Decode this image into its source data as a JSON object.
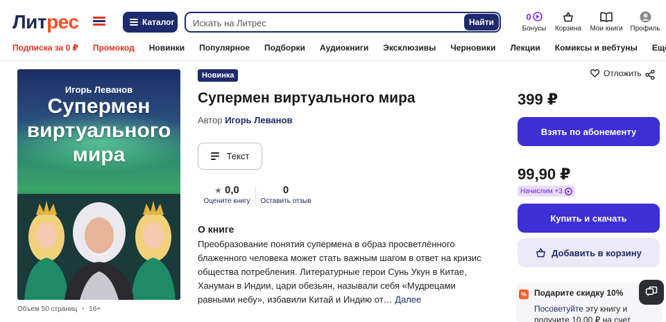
{
  "header": {
    "logo_part1": "Лит",
    "logo_part2": "рес",
    "catalog_label": "Каталог",
    "search_placeholder": "Искать на Литрес",
    "search_button": "Найти",
    "bonus_count": "0",
    "icons": {
      "bonuses": "Бонусы",
      "cart": "Корзина",
      "my_books": "Мои книги",
      "profile": "Профиль"
    }
  },
  "nav": {
    "items": [
      "Подписка за 0 ₽",
      "Промокод",
      "Новинки",
      "Популярное",
      "Подборки",
      "Аудиокниги",
      "Эксклюзивы",
      "Черновики",
      "Лекции",
      "Комиксы и вебтуны",
      "Ещё"
    ]
  },
  "cover": {
    "author": "Игорь Леванов",
    "title": "Супермен виртуального мира"
  },
  "book": {
    "badge": "Новинка",
    "title": "Супермен виртуального мира",
    "author_label": "Автор",
    "author_name": "Игорь Леванов",
    "format_label": "Текст",
    "rating_value": "0,0",
    "rating_label": "Оцените книгу",
    "reviews_value": "0",
    "reviews_label": "Оставить отзыв",
    "about_heading": "О книге",
    "about_text": "Преобразование понятия супермена в образ просветлённого блаженного человека может стать важным шагом в ответ на кризис общества потребления. Литературные герои Сунь Укун в Китае, Хануман в Индии, цари обезьян, называли себя «Мудрецами равными небу», избавили Китай и Индию от…",
    "more_link": "Далее",
    "meta_pages": "Объем 50 страниц",
    "meta_age": "16+"
  },
  "purchase": {
    "postpone_label": "Отложить",
    "subscription_price": "399 ₽",
    "subscription_button": "Взять по абонементу",
    "price": "99,90 ₽",
    "cashback": "Начислим +3",
    "buy_button": "Купить и скачать",
    "cart_button": "Добавить в корзину",
    "promo_title": "Подарите скидку 10%",
    "promo_link": "Посоветуйте",
    "promo_text_rest": " эту книгу и получите 10,00 ₽ на счет"
  },
  "colors": {
    "brand_navy": "#1d2a6c",
    "brand_orange": "#ff4c24",
    "primary_button": "#3c2fd4",
    "accent_red": "#e3331b"
  }
}
